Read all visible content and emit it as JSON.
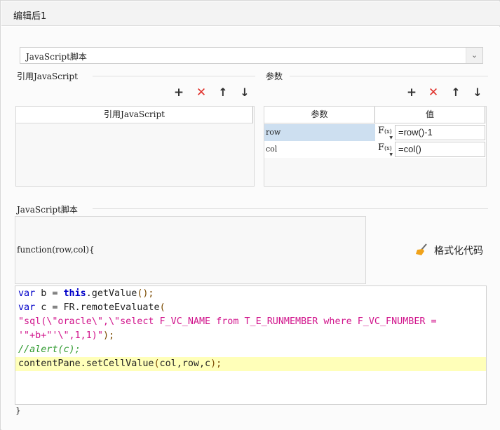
{
  "window": {
    "title": "编辑后1"
  },
  "script_type": {
    "selected": "JavaScript脚本"
  },
  "ref_js": {
    "group_label": "引用JavaScript",
    "column_header": "引用JavaScript",
    "toolbar": {
      "add": "+",
      "delete": "✕",
      "up": "↑",
      "down": "↓"
    }
  },
  "params": {
    "group_label": "参数",
    "headers": {
      "name": "参数",
      "value": "值"
    },
    "toolbar": {
      "add": "+",
      "delete": "✕",
      "up": "↑",
      "down": "↓"
    },
    "rows": [
      {
        "name": "row",
        "formula_label": "F",
        "formula_sub": "(x)",
        "value": "=row()-1",
        "selected": true
      },
      {
        "name": "col",
        "formula_label": "F",
        "formula_sub": "(x)",
        "value": "=col()",
        "selected": false
      }
    ]
  },
  "script": {
    "group_label": "JavaScript脚本",
    "function_header": "function(row,col){",
    "closing_brace": "}",
    "format_button": "格式化代码",
    "code": {
      "l1": {
        "kw": "var",
        "a": " b = ",
        "kwb": "this",
        "b": ".getValue",
        "p": "();"
      },
      "l2": {
        "kw": "var",
        "a": " c = FR.remoteEvaluate",
        "p": "("
      },
      "l3": {
        "s": "\"sql(\\\"oracle\\\",\\\"select F_VC_NAME from T_E_RUNMEMBER where F_VC_FNUMBER ="
      },
      "l4": {
        "s": "'\"+b+\"'\\\",1,1)\"",
        "p": ");"
      },
      "l5": {
        "c": "//alert(c);"
      },
      "l6": {
        "a": "contentPane.setCellValue",
        "p1": "(",
        "b": "col,row,c",
        "p2": ");"
      }
    }
  },
  "colors": {
    "delete_red": "#e0302a",
    "selected_row": "#cddff0",
    "highlight_line": "#ffffb9",
    "keyword": "#0000c8",
    "string": "#d1148c",
    "comment": "#2f9a2f"
  }
}
